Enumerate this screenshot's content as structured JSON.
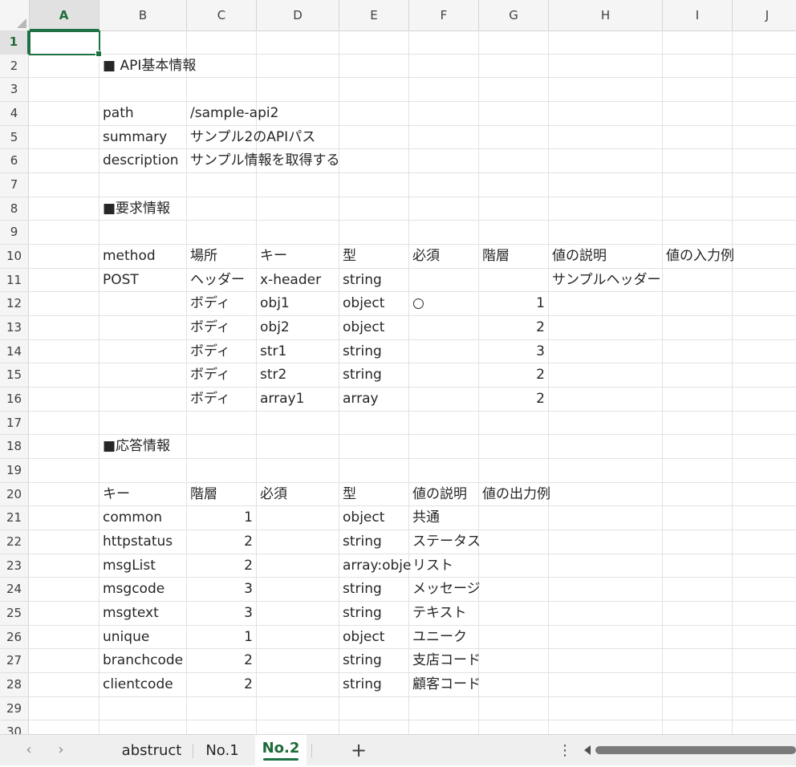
{
  "columns": [
    "A",
    "B",
    "C",
    "D",
    "E",
    "F",
    "G",
    "H",
    "I",
    "J"
  ],
  "rows": [
    "1",
    "2",
    "3",
    "4",
    "5",
    "6",
    "7",
    "8",
    "9",
    "10",
    "11",
    "12",
    "13",
    "14",
    "15",
    "16",
    "17",
    "18",
    "19",
    "20",
    "21",
    "22",
    "23",
    "24",
    "25",
    "26",
    "27",
    "28",
    "29",
    "30"
  ],
  "active_cell": "A1",
  "cells": [
    {
      "row": 2,
      "col": "B",
      "text": "■ API基本情報"
    },
    {
      "row": 4,
      "col": "B",
      "text": "path"
    },
    {
      "row": 4,
      "col": "C",
      "text": "/sample-api2"
    },
    {
      "row": 5,
      "col": "B",
      "text": "summary"
    },
    {
      "row": 5,
      "col": "C",
      "text": "サンプル2のAPIパス"
    },
    {
      "row": 6,
      "col": "B",
      "text": "description"
    },
    {
      "row": 6,
      "col": "C",
      "text": "サンプル情報を取得する"
    },
    {
      "row": 8,
      "col": "B",
      "text": "■要求情報"
    },
    {
      "row": 10,
      "col": "B",
      "text": "method"
    },
    {
      "row": 10,
      "col": "C",
      "text": "場所"
    },
    {
      "row": 10,
      "col": "D",
      "text": "キー"
    },
    {
      "row": 10,
      "col": "E",
      "text": "型"
    },
    {
      "row": 10,
      "col": "F",
      "text": "必須"
    },
    {
      "row": 10,
      "col": "G",
      "text": "階層"
    },
    {
      "row": 10,
      "col": "H",
      "text": "値の説明"
    },
    {
      "row": 10,
      "col": "I",
      "text": "値の入力例"
    },
    {
      "row": 11,
      "col": "B",
      "text": "POST"
    },
    {
      "row": 11,
      "col": "C",
      "text": "ヘッダー"
    },
    {
      "row": 11,
      "col": "D",
      "text": "x-header"
    },
    {
      "row": 11,
      "col": "E",
      "text": "string"
    },
    {
      "row": 11,
      "col": "H",
      "text": "サンプルヘッダー"
    },
    {
      "row": 12,
      "col": "C",
      "text": "ボディ"
    },
    {
      "row": 12,
      "col": "D",
      "text": "obj1"
    },
    {
      "row": 12,
      "col": "E",
      "text": "object"
    },
    {
      "row": 12,
      "col": "F",
      "text": "○"
    },
    {
      "row": 12,
      "col": "G",
      "text": "1",
      "num": true
    },
    {
      "row": 13,
      "col": "C",
      "text": "ボディ"
    },
    {
      "row": 13,
      "col": "D",
      "text": "obj2"
    },
    {
      "row": 13,
      "col": "E",
      "text": "object"
    },
    {
      "row": 13,
      "col": "G",
      "text": "2",
      "num": true
    },
    {
      "row": 14,
      "col": "C",
      "text": "ボディ"
    },
    {
      "row": 14,
      "col": "D",
      "text": "str1"
    },
    {
      "row": 14,
      "col": "E",
      "text": "string"
    },
    {
      "row": 14,
      "col": "G",
      "text": "3",
      "num": true
    },
    {
      "row": 15,
      "col": "C",
      "text": "ボディ"
    },
    {
      "row": 15,
      "col": "D",
      "text": "str2"
    },
    {
      "row": 15,
      "col": "E",
      "text": "string"
    },
    {
      "row": 15,
      "col": "G",
      "text": "2",
      "num": true
    },
    {
      "row": 16,
      "col": "C",
      "text": "ボディ"
    },
    {
      "row": 16,
      "col": "D",
      "text": "array1"
    },
    {
      "row": 16,
      "col": "E",
      "text": "array"
    },
    {
      "row": 16,
      "col": "G",
      "text": "2",
      "num": true
    },
    {
      "row": 18,
      "col": "B",
      "text": "■応答情報"
    },
    {
      "row": 20,
      "col": "B",
      "text": "キー"
    },
    {
      "row": 20,
      "col": "C",
      "text": "階層"
    },
    {
      "row": 20,
      "col": "D",
      "text": "必須"
    },
    {
      "row": 20,
      "col": "E",
      "text": "型"
    },
    {
      "row": 20,
      "col": "F",
      "text": "値の説明"
    },
    {
      "row": 20,
      "col": "G",
      "text": "値の出力例"
    },
    {
      "row": 21,
      "col": "B",
      "text": "common"
    },
    {
      "row": 21,
      "col": "C",
      "text": "1",
      "num": true
    },
    {
      "row": 21,
      "col": "E",
      "text": "object"
    },
    {
      "row": 21,
      "col": "F",
      "text": "共通"
    },
    {
      "row": 22,
      "col": "B",
      "text": "httpstatus"
    },
    {
      "row": 22,
      "col": "C",
      "text": "2",
      "num": true
    },
    {
      "row": 22,
      "col": "E",
      "text": "string"
    },
    {
      "row": 22,
      "col": "F",
      "text": "ステータス"
    },
    {
      "row": 23,
      "col": "B",
      "text": "msgList"
    },
    {
      "row": 23,
      "col": "C",
      "text": "2",
      "num": true
    },
    {
      "row": 23,
      "col": "E",
      "text": "array:obje"
    },
    {
      "row": 23,
      "col": "F",
      "text": "リスト"
    },
    {
      "row": 24,
      "col": "B",
      "text": "msgcode"
    },
    {
      "row": 24,
      "col": "C",
      "text": "3",
      "num": true
    },
    {
      "row": 24,
      "col": "E",
      "text": "string"
    },
    {
      "row": 24,
      "col": "F",
      "text": "メッセージ"
    },
    {
      "row": 25,
      "col": "B",
      "text": "msgtext"
    },
    {
      "row": 25,
      "col": "C",
      "text": "3",
      "num": true
    },
    {
      "row": 25,
      "col": "E",
      "text": "string"
    },
    {
      "row": 25,
      "col": "F",
      "text": "テキスト"
    },
    {
      "row": 26,
      "col": "B",
      "text": "unique"
    },
    {
      "row": 26,
      "col": "C",
      "text": "1",
      "num": true
    },
    {
      "row": 26,
      "col": "E",
      "text": "object"
    },
    {
      "row": 26,
      "col": "F",
      "text": "ユニーク"
    },
    {
      "row": 27,
      "col": "B",
      "text": "branchcode"
    },
    {
      "row": 27,
      "col": "C",
      "text": "2",
      "num": true
    },
    {
      "row": 27,
      "col": "E",
      "text": "string"
    },
    {
      "row": 27,
      "col": "F",
      "text": "支店コード"
    },
    {
      "row": 28,
      "col": "B",
      "text": "clientcode"
    },
    {
      "row": 28,
      "col": "C",
      "text": "2",
      "num": true
    },
    {
      "row": 28,
      "col": "E",
      "text": "string"
    },
    {
      "row": 28,
      "col": "F",
      "text": "顧客コード"
    }
  ],
  "sheet_tabs": {
    "prev": "‹",
    "next": "›",
    "tabs": [
      {
        "label": "abstruct",
        "active": false
      },
      {
        "label": "No.1",
        "active": false
      },
      {
        "label": "No.2",
        "active": true
      }
    ],
    "add": "+",
    "more": "⋮"
  },
  "colors": {
    "accent": "#1e7145"
  }
}
